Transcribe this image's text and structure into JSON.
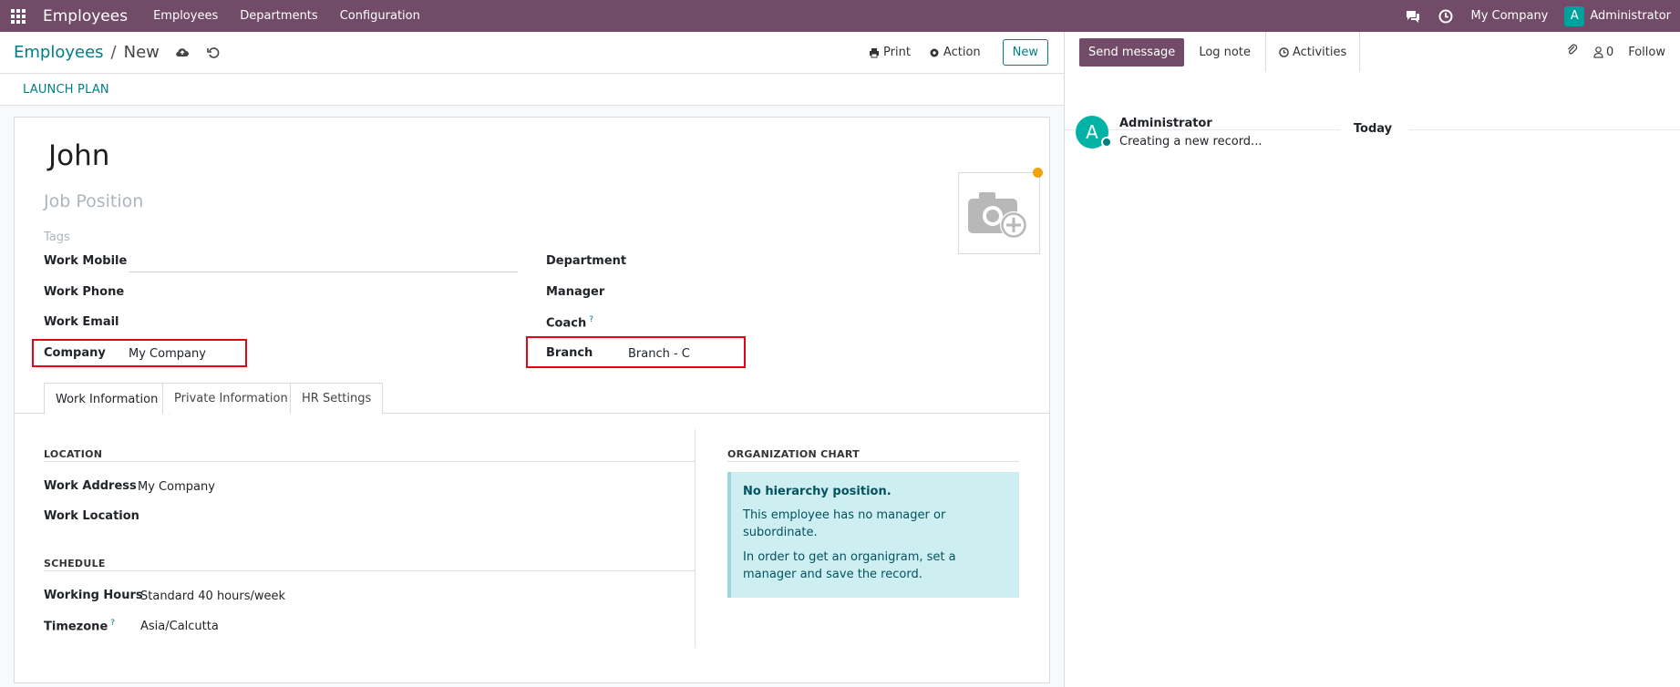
{
  "navbar": {
    "app_title": "Employees",
    "menu": [
      "Employees",
      "Departments",
      "Configuration"
    ],
    "company": "My Company",
    "user_initial": "A",
    "user_name": "Administrator"
  },
  "control": {
    "breadcrumb_parent": "Employees",
    "breadcrumb_sep": "/",
    "breadcrumb_current": "New",
    "print_label": "Print",
    "action_label": "Action",
    "new_label": "New"
  },
  "statusbar": {
    "launch_plan": "LAUNCH PLAN"
  },
  "form": {
    "name": "John",
    "job_placeholder": "Job Position",
    "tags_placeholder": "Tags",
    "work_mobile_label": "Work Mobile",
    "work_mobile_value": "",
    "work_phone_label": "Work Phone",
    "work_email_label": "Work Email",
    "company_label": "Company",
    "company_value": "My Company",
    "department_label": "Department",
    "manager_label": "Manager",
    "coach_label": "Coach",
    "coach_help": "?",
    "branch_label": "Branch",
    "branch_value": "Branch - C"
  },
  "tabs": [
    "Work Information",
    "Private Information",
    "HR Settings"
  ],
  "work_info": {
    "location_title": "LOCATION",
    "work_address_label": "Work Address",
    "work_address_value": "My Company",
    "work_location_label": "Work Location",
    "schedule_title": "SCHEDULE",
    "working_hours_label": "Working Hours",
    "working_hours_value": "Standard 40 hours/week",
    "timezone_label": "Timezone",
    "timezone_help": "?",
    "timezone_value": "Asia/Calcutta",
    "org_title": "ORGANIZATION CHART",
    "org_heading": "No hierarchy position.",
    "org_line1": "This employee has no manager or subordinate.",
    "org_line2": "In order to get an organigram, set a manager and save the record."
  },
  "chatter": {
    "send_message": "Send message",
    "log_note": "Log note",
    "activities": "Activities",
    "follower_count": "0",
    "follow": "Follow",
    "today": "Today",
    "msg_initial": "A",
    "msg_author": "Administrator",
    "msg_body": "Creating a new record..."
  },
  "colors": {
    "brand": "#714b67",
    "accent": "#017e84",
    "highlight": "#e30613",
    "info_bg": "#cdeff2"
  }
}
